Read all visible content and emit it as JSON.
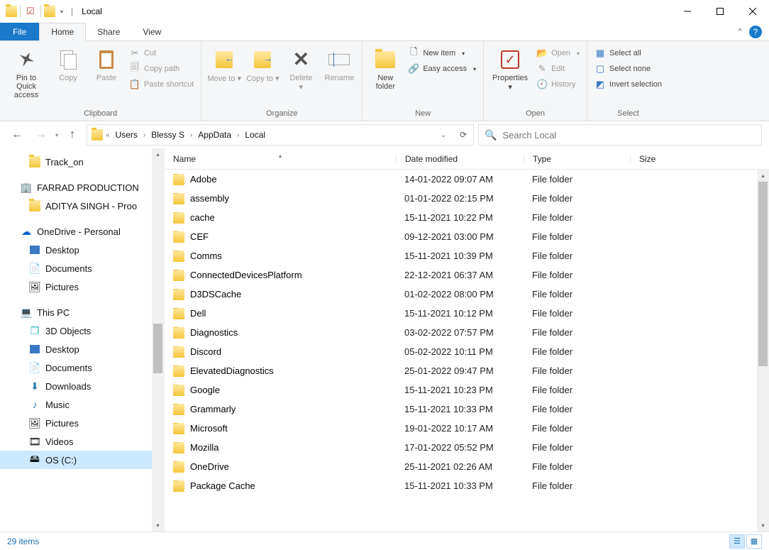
{
  "window": {
    "title": "Local"
  },
  "qat": {
    "chevron": "⌄"
  },
  "tabs": {
    "file": "File",
    "home": "Home",
    "share": "Share",
    "view": "View"
  },
  "ribbon": {
    "clipboard": {
      "pin": "Pin to Quick access",
      "copy": "Copy",
      "paste": "Paste",
      "cut": "Cut",
      "copypath": "Copy path",
      "pasteshort": "Paste shortcut",
      "label": "Clipboard"
    },
    "organize": {
      "moveto": "Move to",
      "copyto": "Copy to",
      "delete": "Delete",
      "rename": "Rename",
      "label": "Organize"
    },
    "new": {
      "newfolder": "New folder",
      "newitem": "New item",
      "easyaccess": "Easy access",
      "label": "New"
    },
    "open": {
      "properties": "Properties",
      "open": "Open",
      "edit": "Edit",
      "history": "History",
      "label": "Open"
    },
    "select": {
      "all": "Select all",
      "none": "Select none",
      "invert": "Invert selection",
      "label": "Select"
    }
  },
  "breadcrumb": [
    "Users",
    "Blessy S",
    "AppData",
    "Local"
  ],
  "search": {
    "placeholder": "Search Local"
  },
  "navpane": {
    "trackon": "Track_on",
    "farrad": "FARRAD PRODUCTION",
    "aditya": "ADITYA SINGH - Proo",
    "onedrive": "OneDrive - Personal",
    "od_desktop": "Desktop",
    "od_documents": "Documents",
    "od_pictures": "Pictures",
    "thispc": "This PC",
    "pc_3d": "3D Objects",
    "pc_desktop": "Desktop",
    "pc_documents": "Documents",
    "pc_downloads": "Downloads",
    "pc_music": "Music",
    "pc_pictures": "Pictures",
    "pc_videos": "Videos",
    "pc_osc": "OS (C:)"
  },
  "columns": {
    "name": "Name",
    "date": "Date modified",
    "type": "Type",
    "size": "Size"
  },
  "files": [
    {
      "name": "Adobe",
      "date": "14-01-2022 09:07 AM",
      "type": "File folder"
    },
    {
      "name": "assembly",
      "date": "01-01-2022 02:15 PM",
      "type": "File folder"
    },
    {
      "name": "cache",
      "date": "15-11-2021 10:22 PM",
      "type": "File folder"
    },
    {
      "name": "CEF",
      "date": "09-12-2021 03:00 PM",
      "type": "File folder"
    },
    {
      "name": "Comms",
      "date": "15-11-2021 10:39 PM",
      "type": "File folder"
    },
    {
      "name": "ConnectedDevicesPlatform",
      "date": "22-12-2021 06:37 AM",
      "type": "File folder"
    },
    {
      "name": "D3DSCache",
      "date": "01-02-2022 08:00 PM",
      "type": "File folder"
    },
    {
      "name": "Dell",
      "date": "15-11-2021 10:12 PM",
      "type": "File folder"
    },
    {
      "name": "Diagnostics",
      "date": "03-02-2022 07:57 PM",
      "type": "File folder"
    },
    {
      "name": "Discord",
      "date": "05-02-2022 10:11 PM",
      "type": "File folder"
    },
    {
      "name": "ElevatedDiagnostics",
      "date": "25-01-2022 09:47 PM",
      "type": "File folder"
    },
    {
      "name": "Google",
      "date": "15-11-2021 10:23 PM",
      "type": "File folder"
    },
    {
      "name": "Grammarly",
      "date": "15-11-2021 10:33 PM",
      "type": "File folder"
    },
    {
      "name": "Microsoft",
      "date": "19-01-2022 10:17 AM",
      "type": "File folder"
    },
    {
      "name": "Mozilla",
      "date": "17-01-2022 05:52 PM",
      "type": "File folder"
    },
    {
      "name": "OneDrive",
      "date": "25-11-2021 02:26 AM",
      "type": "File folder"
    },
    {
      "name": "Package Cache",
      "date": "15-11-2021 10:33 PM",
      "type": "File folder"
    }
  ],
  "status": {
    "count": "29 items"
  }
}
